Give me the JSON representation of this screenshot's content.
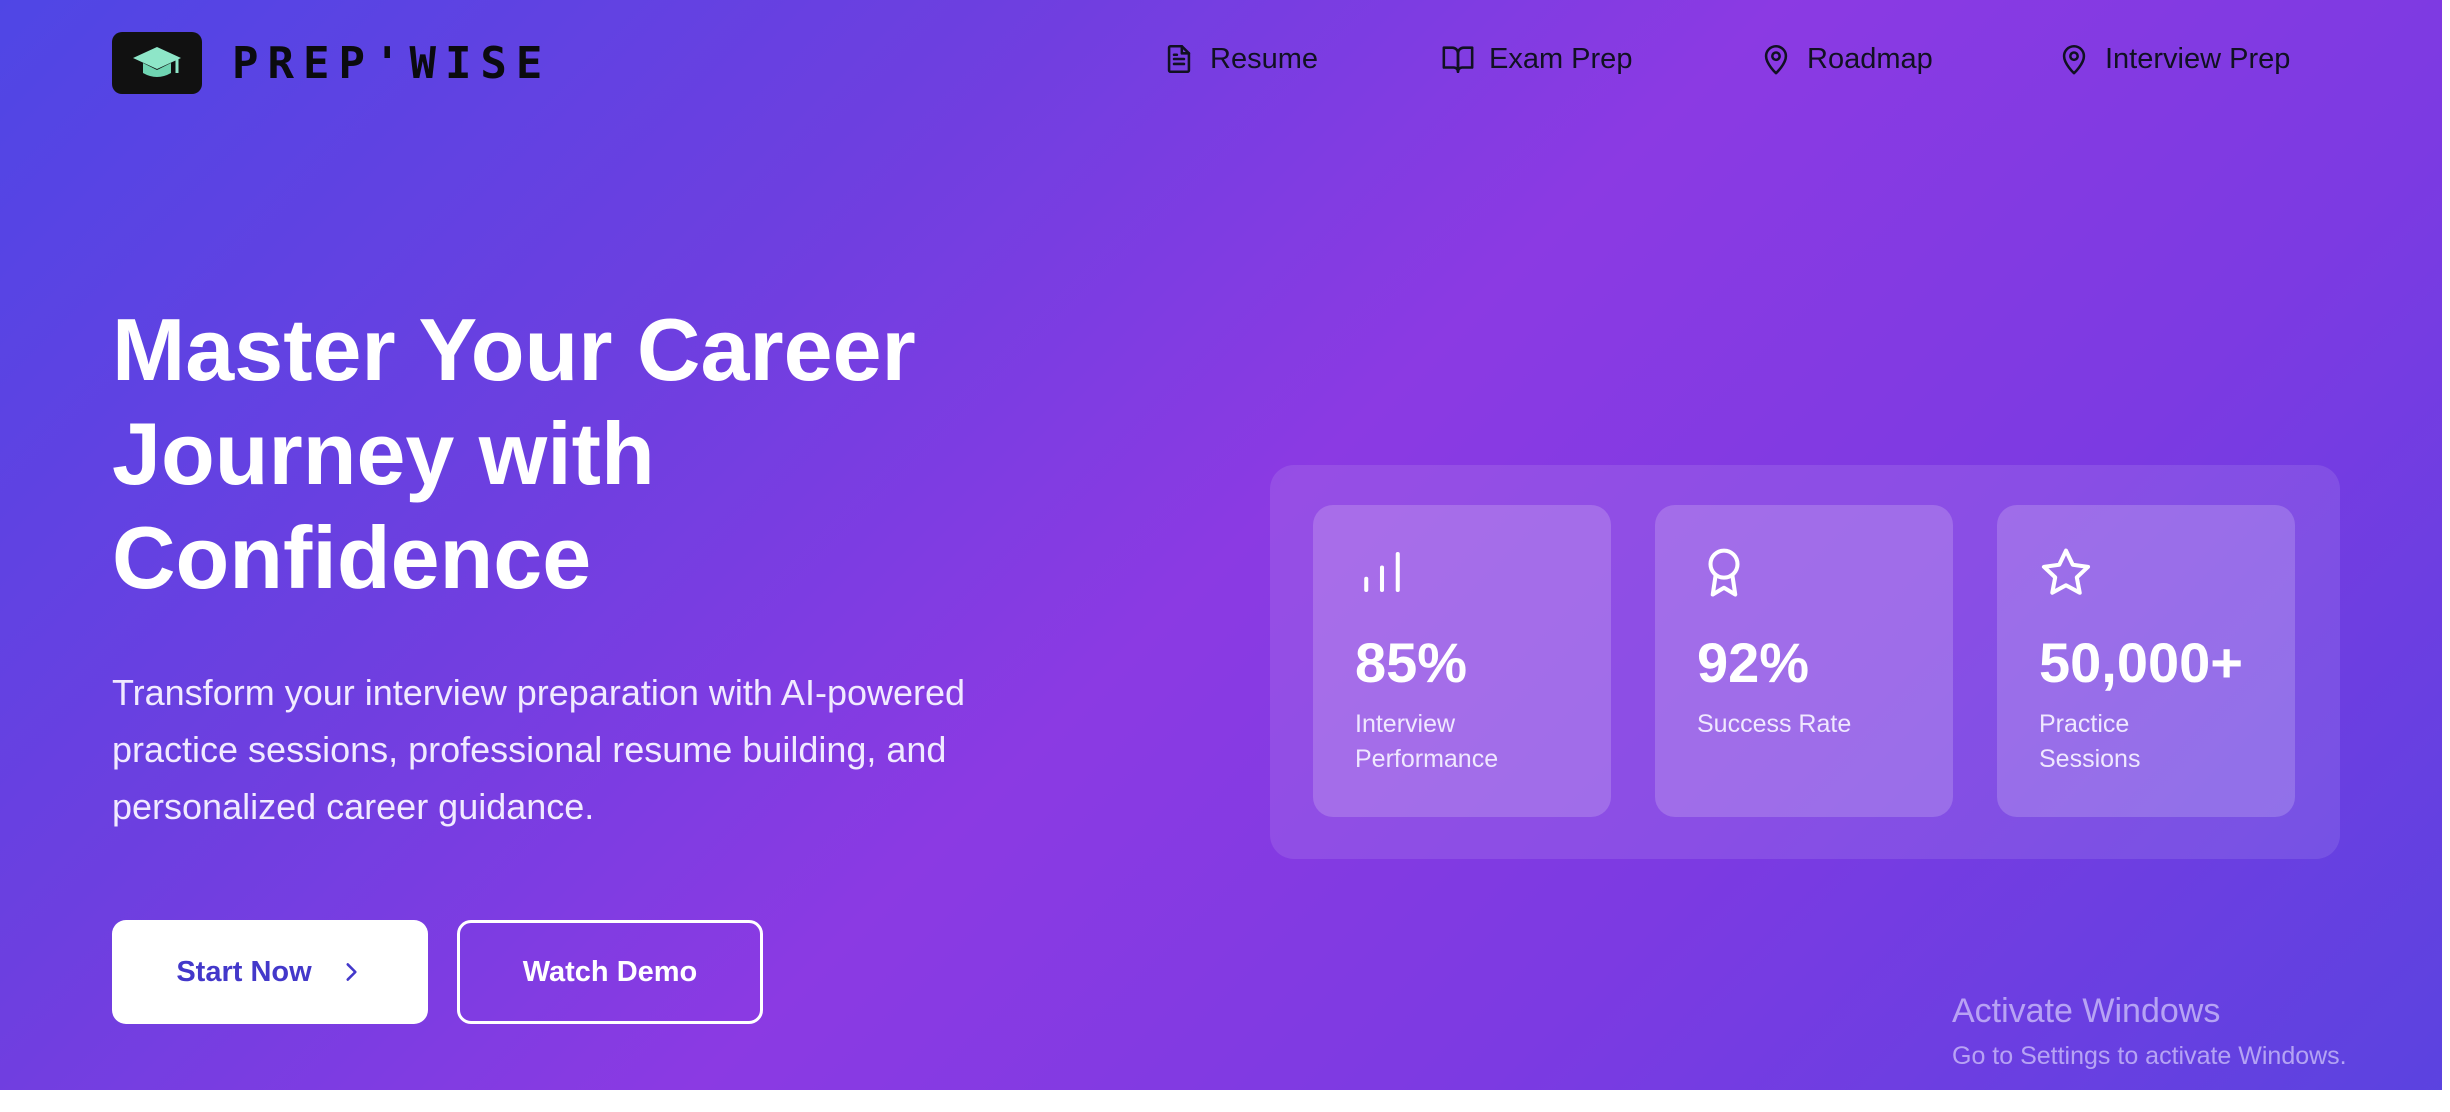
{
  "brand": {
    "name": "PREP'WISE",
    "logo_icon": "graduation-cap-icon"
  },
  "nav": {
    "items": [
      {
        "label": "Resume",
        "icon": "document-icon"
      },
      {
        "label": "Exam Prep",
        "icon": "open-book-icon"
      },
      {
        "label": "Roadmap",
        "icon": "map-pin-icon"
      },
      {
        "label": "Interview Prep",
        "icon": "map-pin-icon"
      }
    ]
  },
  "hero": {
    "title_lines": [
      "Master Your Career",
      "Journey with",
      "Confidence"
    ],
    "subtitle_lines": [
      "Transform your interview preparation with AI-powered",
      "practice sessions, professional resume building, and",
      "personalized career guidance."
    ],
    "primary_button": "Start Now",
    "secondary_button": "Watch Demo"
  },
  "stats": [
    {
      "value": "85%",
      "label_lines": [
        "Interview",
        "Performance"
      ],
      "icon": "bar-chart-icon"
    },
    {
      "value": "92%",
      "label_lines": [
        "Success Rate"
      ],
      "icon": "award-icon"
    },
    {
      "value": "50,000+",
      "label_lines": [
        "Practice",
        "Sessions"
      ],
      "icon": "star-icon"
    }
  ],
  "watermark": {
    "title": "Activate Windows",
    "subtitle": "Go to Settings to activate Windows."
  },
  "colors": {
    "background_start": "#4f46e5",
    "background_mid": "#8b3ae3",
    "primary_button_text": "#4338ca",
    "logo_accent": "#8ee6c8"
  }
}
